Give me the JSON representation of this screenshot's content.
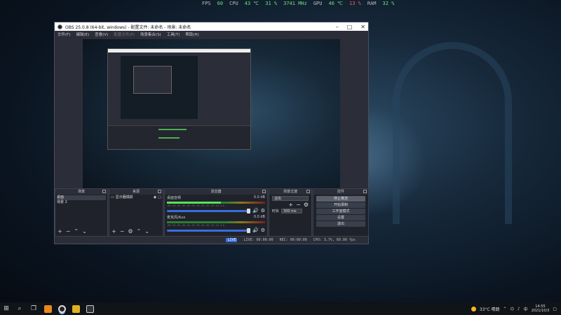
{
  "overlay": {
    "fps_label": "FPS",
    "fps_value": "60",
    "cpu_label": "CPU",
    "cpu_temp": "43 ℃",
    "cpu_load": "31 %",
    "cpu_clock": "3741 MHz",
    "gpu_label": "GPU",
    "gpu_temp": "46 ℃",
    "gpu_load": "13 %",
    "ram_label": "RAM",
    "ram_load": "32 %"
  },
  "window": {
    "title": "OBS 25.0.8 (64-bit, windows) - 配置文件: 未命名 - 场景: 未命名",
    "minimize": "–",
    "maximize": "□",
    "close": "✕"
  },
  "menu": {
    "items": [
      "文件(F)",
      "编辑(E)",
      "查看(V)",
      "配置文件(P)",
      "场景集合(S)",
      "工具(T)",
      "帮助(H)"
    ]
  },
  "docks": {
    "scenes": {
      "title": "场景",
      "items": [
        "桌面",
        "场景 2"
      ]
    },
    "sources": {
      "title": "来源",
      "items": [
        "显示器捕获"
      ]
    },
    "mixer": {
      "title": "混音器",
      "channels": [
        {
          "name": "桌面音频",
          "db": "0.0 dB",
          "level": 0.55
        },
        {
          "name": "麦克风/Aux",
          "db": "0.0 dB",
          "level": 0.0
        }
      ],
      "scale": "-60  -55  -50  -45  -40  -35  -30  -25  -20  -15  -10  -5  0"
    },
    "transitions": {
      "title": "场景过渡",
      "selected": "淡出",
      "duration_label": "时长",
      "duration_value": "300 ms"
    },
    "controls": {
      "title": "控件",
      "buttons": [
        "停止推流",
        "开始录制",
        "工作室模式",
        "设置",
        "退出"
      ]
    }
  },
  "status": {
    "live_badge": "LIVE",
    "live_time": "LIVE: 00:00:00",
    "rec_time": "REC: 00:00:00",
    "cpu_fps": "CPU: 3.7%, 60.00 fps"
  },
  "taskbar": {
    "weather": "33°C 晴朗",
    "time": "14:55",
    "date": "2021/10/3"
  }
}
